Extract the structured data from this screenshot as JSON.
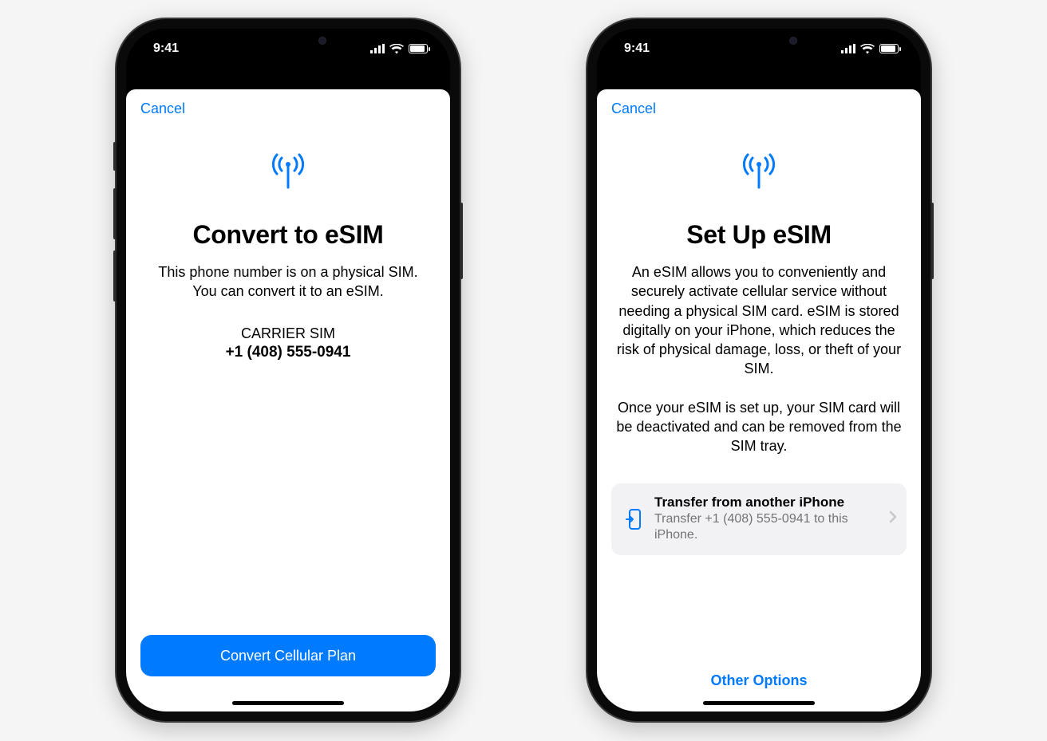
{
  "status": {
    "time": "9:41"
  },
  "phone1": {
    "cancel": "Cancel",
    "title": "Convert to eSIM",
    "subtitle": "This phone number is on a physical SIM. You can convert it to an eSIM.",
    "carrier_label": "CARRIER SIM",
    "carrier_phone": "+1 (408) 555-0941",
    "primary_button": "Convert Cellular Plan"
  },
  "phone2": {
    "cancel": "Cancel",
    "title": "Set Up eSIM",
    "para1": "An eSIM allows you to conveniently and securely activate cellular service without needing a physical SIM card. eSIM is stored digitally on your iPhone, which reduces the risk of physical damage, loss, or theft of your SIM.",
    "para2": "Once your eSIM is set up, your SIM card will be deactivated and can be removed from the SIM tray.",
    "transfer_title": "Transfer from another iPhone",
    "transfer_sub": "Transfer +1 (408) 555-0941 to this iPhone.",
    "other_options": "Other Options"
  },
  "colors": {
    "accent": "#007aff"
  }
}
